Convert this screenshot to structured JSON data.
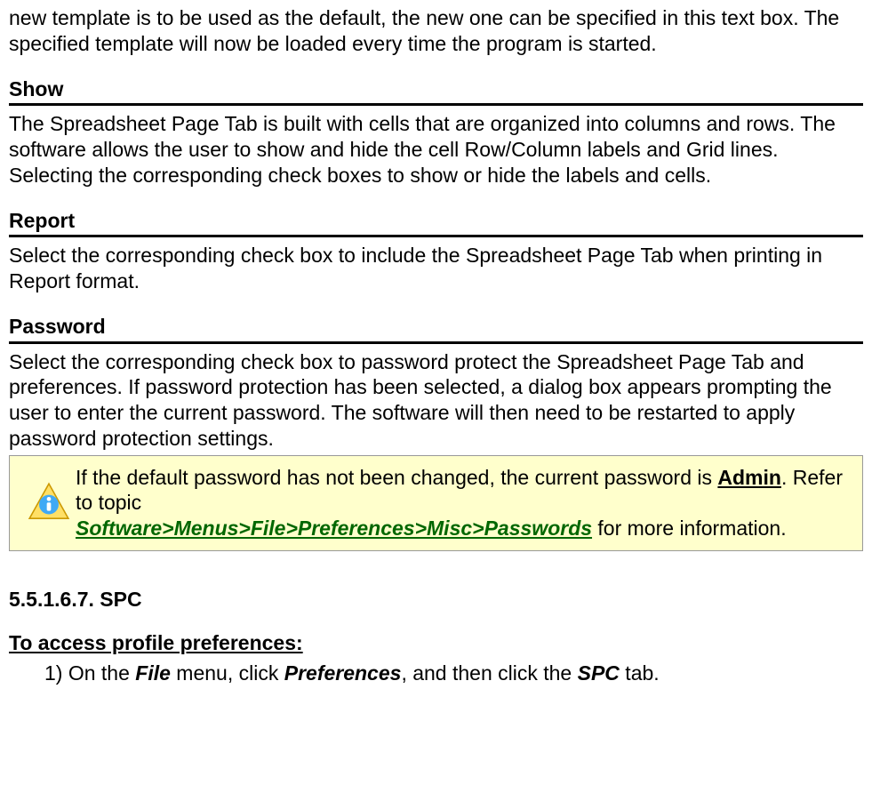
{
  "intro": "new template is to be used as the default, the new one can be specified in this text box. The specified template will now be loaded every time the program is started.",
  "sections": {
    "show": {
      "title": "Show",
      "body": "The Spreadsheet Page Tab is built with cells that are organized into columns and rows. The software allows the user to show and hide the cell Row/Column labels and Grid lines. Selecting the corresponding check boxes to show or hide the labels and cells."
    },
    "report": {
      "title": "Report",
      "body": "Select the corresponding check box to include the Spreadsheet Page Tab when printing in Report format."
    },
    "password": {
      "title": "Password",
      "body": "Select the corresponding check box to password protect the Spreadsheet Page Tab and preferences. If password protection has been selected, a dialog box appears prompting the user to enter the current password. The software will then need to be restarted to apply password protection settings.",
      "note": {
        "pre": "If the default password has not been changed, the current password is ",
        "admin": "Admin",
        "mid": ". Refer to topic ",
        "link": "Software>Menus>File>Preferences>Misc>Passwords",
        "post": " for more information."
      }
    }
  },
  "spc": {
    "numbered_title": "5.5.1.6.7. SPC",
    "subheading": "To access profile preferences:",
    "step1": {
      "pre": "1) On the ",
      "m1": "File",
      "mid1": " menu, click ",
      "m2": "Preferences",
      "mid2": ", and then click the ",
      "m3": "SPC",
      "post": " tab."
    }
  }
}
